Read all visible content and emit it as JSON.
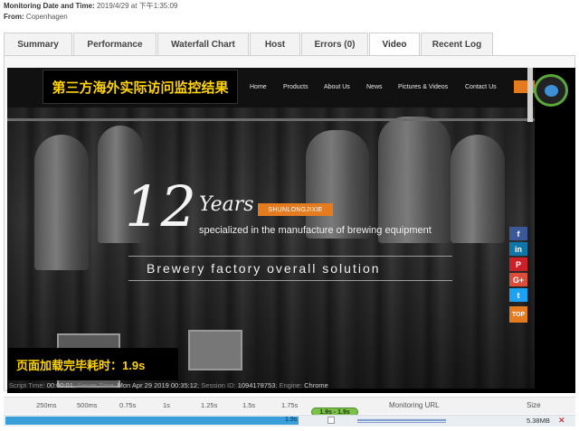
{
  "meta": {
    "date_label": "Monitoring Date and Time:",
    "date_value": "2019/4/29 at 下午1:35:09",
    "from_label": "From:",
    "from_value": "Copenhagen"
  },
  "tabs": [
    {
      "label": "Summary"
    },
    {
      "label": "Performance"
    },
    {
      "label": "Waterfall Chart"
    },
    {
      "label": "Host"
    },
    {
      "label": "Errors (0)"
    },
    {
      "label": "Video"
    },
    {
      "label": "Recent Log"
    }
  ],
  "active_tab": "Video",
  "video": {
    "site_nav": [
      "Home",
      "Products",
      "About Us",
      "News",
      "Pictures & Videos",
      "Contact Us"
    ],
    "hero_number": "12",
    "hero_years": "Years",
    "hero_brand": "SHUNLONGJIXIE",
    "hero_specialized": "specialized in the manufacture of brewing equipment",
    "hero_solution": "Brewery factory overall solution",
    "social": [
      {
        "icon": "facebook-icon",
        "label": "f",
        "color": "#3b5998"
      },
      {
        "icon": "linkedin-icon",
        "label": "in",
        "color": "#0e76a8"
      },
      {
        "icon": "pinterest-icon",
        "label": "P",
        "color": "#cb2027"
      },
      {
        "icon": "google-plus-icon",
        "label": "G+",
        "color": "#dd4b39"
      },
      {
        "icon": "twitter-icon",
        "label": "t",
        "color": "#1da1f2"
      }
    ],
    "top_button": "TOP",
    "overlay_title": "第三方海外实际访问监控结果",
    "overlay_load": "页面加载完毕耗时：1.9s",
    "accent_color": "#e57b1f",
    "overlay_color": "#ffd400"
  },
  "script_info": {
    "script_time_label": "Script Time:",
    "script_time": "00:00:01",
    "server_time_label": "Server Time:",
    "server_time": "Mon Apr 29 2019 00:35:12",
    "session_label": "Session ID:",
    "session_id": "1094178753",
    "engine_label": "Engine:",
    "engine": "Chrome"
  },
  "timeline": {
    "ticks": [
      "250ms",
      "500ms",
      "0.75s",
      "1s",
      "1.25s",
      "1.5s",
      "1.75s"
    ],
    "range_label": "1.9s - 1.9s",
    "url_header": "Monitoring URL",
    "size_header": "Size"
  },
  "row": {
    "bar_label": "1.9s",
    "size": "5.38MB",
    "mark": "✕"
  }
}
